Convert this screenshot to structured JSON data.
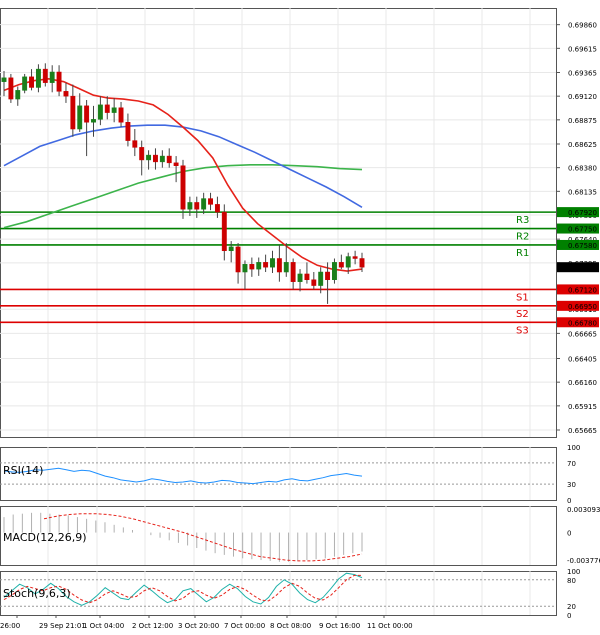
{
  "chart_data": {
    "type": "candlestick",
    "grid": true,
    "x_tick_labels": [
      "26:00",
      "29 Sep 21:01",
      "1 Oct 04:00",
      "2 Oct 12:00",
      "3 Oct 20:00",
      "7 Oct 00:00",
      "8 Oct 08:00",
      "9 Oct 16:00",
      "11 Oct 00:00"
    ],
    "main": {
      "ylim": [
        0.65665,
        0.6996
      ],
      "y_tick_labels": [
        "0.69860",
        "0.69615",
        "0.69365",
        "0.69120",
        "0.68875",
        "0.68625",
        "0.68380",
        "0.68135",
        "0.67890",
        "0.67640",
        "0.67395",
        "0.66915",
        "0.66665",
        "0.66405",
        "0.66160",
        "0.65915",
        "0.65665"
      ],
      "y_tick_values": [
        0.6986,
        0.69615,
        0.69365,
        0.6912,
        0.68875,
        0.68625,
        0.6838,
        0.68135,
        0.6789,
        0.6764,
        0.67395,
        0.66915,
        0.66665,
        0.66405,
        0.6616,
        0.65915,
        0.65665
      ],
      "current_price": "0.67347",
      "levels": [
        {
          "name": "R3",
          "value": 0.6792,
          "label": "0.67920",
          "color": "#008000"
        },
        {
          "name": "R2",
          "value": 0.6775,
          "label": "0.67750",
          "color": "#008000"
        },
        {
          "name": "R1",
          "value": 0.6758,
          "label": "0.67580",
          "color": "#008000"
        },
        {
          "name": "S1",
          "value": 0.6712,
          "label": "0.67120",
          "color": "#dd0000"
        },
        {
          "name": "S2",
          "value": 0.6695,
          "label": "0.66950",
          "color": "#dd0000"
        },
        {
          "name": "S3",
          "value": 0.6678,
          "label": "0.66780",
          "color": "#dd0000"
        }
      ],
      "candles": [
        [
          0.6927,
          0.6938,
          0.6912,
          0.6931
        ],
        [
          0.6931,
          0.6935,
          0.6905,
          0.6909
        ],
        [
          0.6909,
          0.6922,
          0.6902,
          0.6918
        ],
        [
          0.6918,
          0.6935,
          0.6915,
          0.6932
        ],
        [
          0.6932,
          0.694,
          0.6918,
          0.6921
        ],
        [
          0.6921,
          0.6945,
          0.6916,
          0.694
        ],
        [
          0.694,
          0.6946,
          0.6922,
          0.6926
        ],
        [
          0.6926,
          0.6944,
          0.6916,
          0.6937
        ],
        [
          0.6937,
          0.6944,
          0.6912,
          0.6917
        ],
        [
          0.6917,
          0.6926,
          0.6905,
          0.6912
        ],
        [
          0.6912,
          0.6924,
          0.687,
          0.6878
        ],
        [
          0.6878,
          0.6915,
          0.6875,
          0.6902
        ],
        [
          0.6902,
          0.6908,
          0.685,
          0.6885
        ],
        [
          0.6885,
          0.6902,
          0.687,
          0.6888
        ],
        [
          0.6888,
          0.6912,
          0.6882,
          0.6903
        ],
        [
          0.6903,
          0.6912,
          0.6888,
          0.6895
        ],
        [
          0.6895,
          0.691,
          0.6885,
          0.69
        ],
        [
          0.69,
          0.6906,
          0.688,
          0.6885
        ],
        [
          0.6885,
          0.6894,
          0.686,
          0.6866
        ],
        [
          0.6866,
          0.6878,
          0.685,
          0.6859
        ],
        [
          0.6859,
          0.6866,
          0.683,
          0.6846
        ],
        [
          0.6846,
          0.6856,
          0.6836,
          0.6851
        ],
        [
          0.6851,
          0.6858,
          0.6836,
          0.6844
        ],
        [
          0.6844,
          0.6856,
          0.6838,
          0.685
        ],
        [
          0.685,
          0.6858,
          0.6838,
          0.6843
        ],
        [
          0.6843,
          0.685,
          0.6823,
          0.684
        ],
        [
          0.684,
          0.6846,
          0.6785,
          0.6795
        ],
        [
          0.6795,
          0.6808,
          0.6788,
          0.6802
        ],
        [
          0.6802,
          0.6808,
          0.6786,
          0.6795
        ],
        [
          0.6795,
          0.6812,
          0.679,
          0.6806
        ],
        [
          0.6806,
          0.6812,
          0.6794,
          0.68
        ],
        [
          0.68,
          0.6808,
          0.6786,
          0.6792
        ],
        [
          0.6792,
          0.68,
          0.6742,
          0.6752
        ],
        [
          0.6752,
          0.6762,
          0.674,
          0.6756
        ],
        [
          0.6756,
          0.676,
          0.6718,
          0.673
        ],
        [
          0.673,
          0.6742,
          0.6712,
          0.6738
        ],
        [
          0.6738,
          0.6745,
          0.6725,
          0.6733
        ],
        [
          0.6733,
          0.6745,
          0.6726,
          0.674
        ],
        [
          0.674,
          0.6748,
          0.673,
          0.6735
        ],
        [
          0.6735,
          0.6752,
          0.6729,
          0.6744
        ],
        [
          0.6744,
          0.6758,
          0.672,
          0.673
        ],
        [
          0.673,
          0.676,
          0.6725,
          0.674
        ],
        [
          0.674,
          0.6744,
          0.6712,
          0.672
        ],
        [
          0.672,
          0.6733,
          0.671,
          0.6728
        ],
        [
          0.6728,
          0.674,
          0.6718,
          0.6722
        ],
        [
          0.6722,
          0.673,
          0.6712,
          0.6716
        ],
        [
          0.6716,
          0.6735,
          0.6708,
          0.673
        ],
        [
          0.673,
          0.674,
          0.6697,
          0.6722
        ],
        [
          0.6722,
          0.6744,
          0.6718,
          0.674
        ],
        [
          0.674,
          0.6748,
          0.6733,
          0.6735
        ],
        [
          0.6735,
          0.675,
          0.6728,
          0.6746
        ],
        [
          0.6746,
          0.6752,
          0.6738,
          0.6744
        ],
        [
          0.6744,
          0.675,
          0.673,
          0.6735
        ]
      ],
      "ma_fast": [
        0.6918,
        0.6924,
        0.6928,
        0.693,
        0.6927,
        0.692,
        0.6913,
        0.691,
        0.6909,
        0.6907,
        0.6903,
        0.6893,
        0.688,
        0.6866,
        0.6848,
        0.682,
        0.6796,
        0.678,
        0.6768,
        0.6756,
        0.6745,
        0.6737,
        0.6733,
        0.6731,
        0.6733
      ],
      "ma_mid": [
        0.684,
        0.685,
        0.686,
        0.6866,
        0.6872,
        0.6876,
        0.6879,
        0.6881,
        0.6882,
        0.6882,
        0.688,
        0.6876,
        0.687,
        0.6862,
        0.6854,
        0.6845,
        0.6836,
        0.6827,
        0.6818,
        0.6808,
        0.6797
      ],
      "ma_slow": [
        0.6776,
        0.6782,
        0.679,
        0.6798,
        0.6806,
        0.6814,
        0.6822,
        0.6828,
        0.6834,
        0.6838,
        0.684,
        0.6841,
        0.6841,
        0.684,
        0.6839,
        0.6837,
        0.6836
      ]
    },
    "rsi": {
      "title": "RSI(14)",
      "levels": [
        70,
        30
      ],
      "y_tick_labels": [
        "100",
        "70",
        "30",
        "0"
      ],
      "values": [
        55,
        53,
        52,
        54,
        57,
        56,
        58,
        60,
        57,
        54,
        56,
        55,
        50,
        45,
        42,
        38,
        36,
        34,
        36,
        40,
        38,
        35,
        33,
        34,
        36,
        33,
        32,
        34,
        37,
        36,
        33,
        32,
        31,
        33,
        35,
        34,
        38,
        40,
        37,
        36,
        39,
        42,
        46,
        48,
        50,
        47,
        45
      ]
    },
    "macd": {
      "title": "MACD(12,26,9)",
      "y_tick_labels": [
        "0.003093",
        "0",
        "-0.003776"
      ],
      "ylim": [
        -0.003776,
        0.003093
      ],
      "histogram": [
        0.0018,
        0.0021,
        0.0022,
        0.0023,
        0.0023,
        0.0022,
        0.0021,
        0.002,
        0.0018,
        0.0016,
        0.0014,
        0.0012,
        0.0009,
        0.0006,
        0.0003,
        0.0,
        -0.0003,
        -0.0006,
        -0.0009,
        -0.0012,
        -0.0015,
        -0.0018,
        -0.0021,
        -0.0024,
        -0.0026,
        -0.0028,
        -0.003,
        -0.0031,
        -0.0032,
        -0.0033,
        -0.0034,
        -0.0034,
        -0.0033,
        -0.0032,
        -0.0031,
        -0.003,
        -0.0028,
        -0.0026,
        -0.0024,
        -0.0022
      ],
      "signal": [
        0.0016,
        0.0019,
        0.0021,
        0.0022,
        0.0022,
        0.0021,
        0.0019,
        0.0016,
        0.0012,
        0.0008,
        0.0004,
        0.0,
        -0.0005,
        -0.001,
        -0.0015,
        -0.002,
        -0.0024,
        -0.0028,
        -0.003,
        -0.0032,
        -0.0033,
        -0.0033,
        -0.0032,
        -0.003,
        -0.0028,
        -0.0025
      ]
    },
    "stoch": {
      "title": "Stoch(9,6,3)",
      "levels": [
        80,
        20
      ],
      "y_tick_labels": [
        "100",
        "80",
        "20",
        "0"
      ],
      "main": [
        40,
        55,
        70,
        62,
        48,
        58,
        72,
        60,
        42,
        30,
        22,
        30,
        45,
        62,
        50,
        38,
        35,
        52,
        68,
        55,
        40,
        28,
        35,
        55,
        60,
        45,
        30,
        40,
        58,
        70,
        60,
        42,
        30,
        25,
        40,
        65,
        80,
        70,
        50,
        35,
        28,
        40,
        60,
        82,
        95,
        92,
        85
      ],
      "signal": [
        35,
        45,
        58,
        65,
        60,
        55,
        62,
        66,
        58,
        45,
        34,
        28,
        35,
        48,
        55,
        48,
        40,
        42,
        55,
        62,
        55,
        42,
        32,
        38,
        52,
        55,
        45,
        38,
        45,
        58,
        65,
        58,
        45,
        34,
        32,
        45,
        62,
        72,
        65,
        50,
        38,
        34,
        45,
        62,
        80,
        90,
        90
      ]
    }
  }
}
